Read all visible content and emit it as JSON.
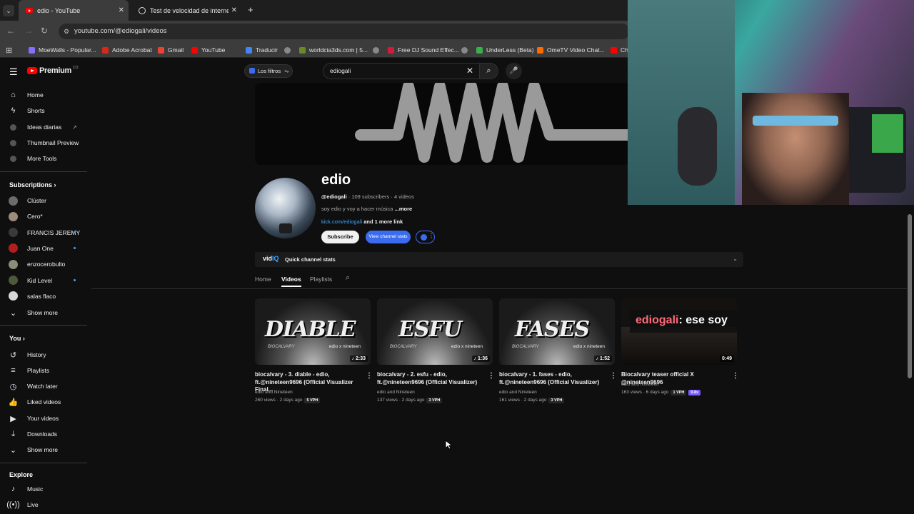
{
  "browser": {
    "tabs": [
      {
        "title": "edio - YouTube",
        "close": "✕"
      },
      {
        "title": "Test de velocidad de internet |",
        "close": "✕"
      }
    ],
    "new_tab": "+",
    "url": "youtube.com/@ediogali/videos",
    "bookmarks": [
      {
        "label": "MoeWalls - Popular...",
        "color": "#8a6cff"
      },
      {
        "label": "Adobe Acrobat",
        "color": "#d7281e"
      },
      {
        "label": "Gmail",
        "color": "#ea4335"
      },
      {
        "label": "YouTube",
        "color": "#ff0000"
      },
      {
        "label": "Traducir",
        "color": "#4285f4"
      },
      {
        "label": "worldcia3ds.com | 5...",
        "color": "#6a8a2a"
      },
      {
        "label": "Free DJ Sound Effec...",
        "color": "#d41a3a"
      },
      {
        "label": "UnderLess (Beta)",
        "color": "#3aaf4a"
      },
      {
        "label": "OmeTV Video Chat...",
        "color": "#ff6a00"
      },
      {
        "label": "Ch",
        "color": "#ff0000"
      }
    ]
  },
  "header": {
    "logo": "Premium",
    "logo_sup": "CO",
    "filter_pill": "Los filtros",
    "search_value": "ediogali"
  },
  "sidebar": {
    "main": [
      "Home",
      "Shorts",
      "Ideas diarias",
      "Thumbnail Preview",
      "More Tools"
    ],
    "subscriptions_title": "Subscriptions",
    "subscriptions": [
      {
        "name": "Clúster",
        "dot": false,
        "color": "#6b6b6b"
      },
      {
        "name": "Cero*",
        "dot": false,
        "color": "#9c8c7c"
      },
      {
        "name": "FRANCIS JEREMY",
        "dot": true,
        "color": "#3a3a3a"
      },
      {
        "name": "Juan One",
        "dot": true,
        "color": "#b21e1e"
      },
      {
        "name": "enzocerobulto",
        "dot": false,
        "color": "#8c8c7a"
      },
      {
        "name": "Kid Level",
        "dot": true,
        "color": "#4c5a3a"
      },
      {
        "name": "salas flaco",
        "dot": false,
        "color": "#d8d8d8"
      }
    ],
    "show_more": "Show more",
    "you_title": "You",
    "you_items": [
      "History",
      "Playlists",
      "Watch later",
      "Liked videos",
      "Your videos",
      "Downloads"
    ],
    "show_more_2": "Show more",
    "explore_title": "Explore",
    "explore_items": [
      "Music",
      "Live"
    ]
  },
  "channel": {
    "name": "edio",
    "handle": "@ediogali",
    "stats": "· 109 subscribers · 4 videos",
    "description": "soy edio y voy a hacer música",
    "more": "...more",
    "link": "kick.com/ediogali",
    "more_links": "and 1 more link",
    "subscribe": "Subscribe",
    "view_stats": "View channel stats",
    "vidiq_brand": "vid",
    "vidiq_brand_accent": "IQ",
    "vidiq_stats": "Quick channel stats",
    "tabs": [
      "Home",
      "Videos",
      "Playlists"
    ],
    "active_tab": "Videos"
  },
  "videos": [
    {
      "thumb_text": "DIABLE",
      "duration": "2:33",
      "title": "biocalvary - 3. diable - edio, ft.@nineteen9696 (Official Visualizer Final...",
      "channel": "edio and Nineteen",
      "meta": "260 views · 2 days ago",
      "vph": "5 VPH"
    },
    {
      "thumb_text": "ESFU",
      "duration": "1:36",
      "title": "biocalvary - 2. esfu - edio, ft.@nineteen9696 (Official Visualizer)",
      "channel": "edio and Nineteen",
      "meta": "137 views · 2 days ago",
      "vph": "3 VPH"
    },
    {
      "thumb_text": "FASES",
      "duration": "1:52",
      "title": "biocalvary - 1. fases - edio, ft.@nineteen9696 (Official Visualizer)",
      "channel": "edio and Nineteen",
      "meta": "161 views · 2 days ago",
      "vph": "3 VPH"
    },
    {
      "thumb_text": "",
      "duration": "0:49",
      "title": "Biocalvary teaser official X @nineteen9696",
      "channel": "edio and Nineteen",
      "meta": "163 views · 6 days ago",
      "vph": "1 VPH",
      "badge": "9.8x"
    }
  ],
  "thumb_small": "BIOCALVARY",
  "thumb_credit": "edio x nineteen",
  "chat_overlay": {
    "user": "ediogali",
    "message": ": ese soy"
  },
  "colors": {
    "youtube_red": "#ff0000",
    "accent_blue": "#3ea6ff",
    "chat_user": "#ff6b7a",
    "vph_purple": "#7b5cff"
  }
}
